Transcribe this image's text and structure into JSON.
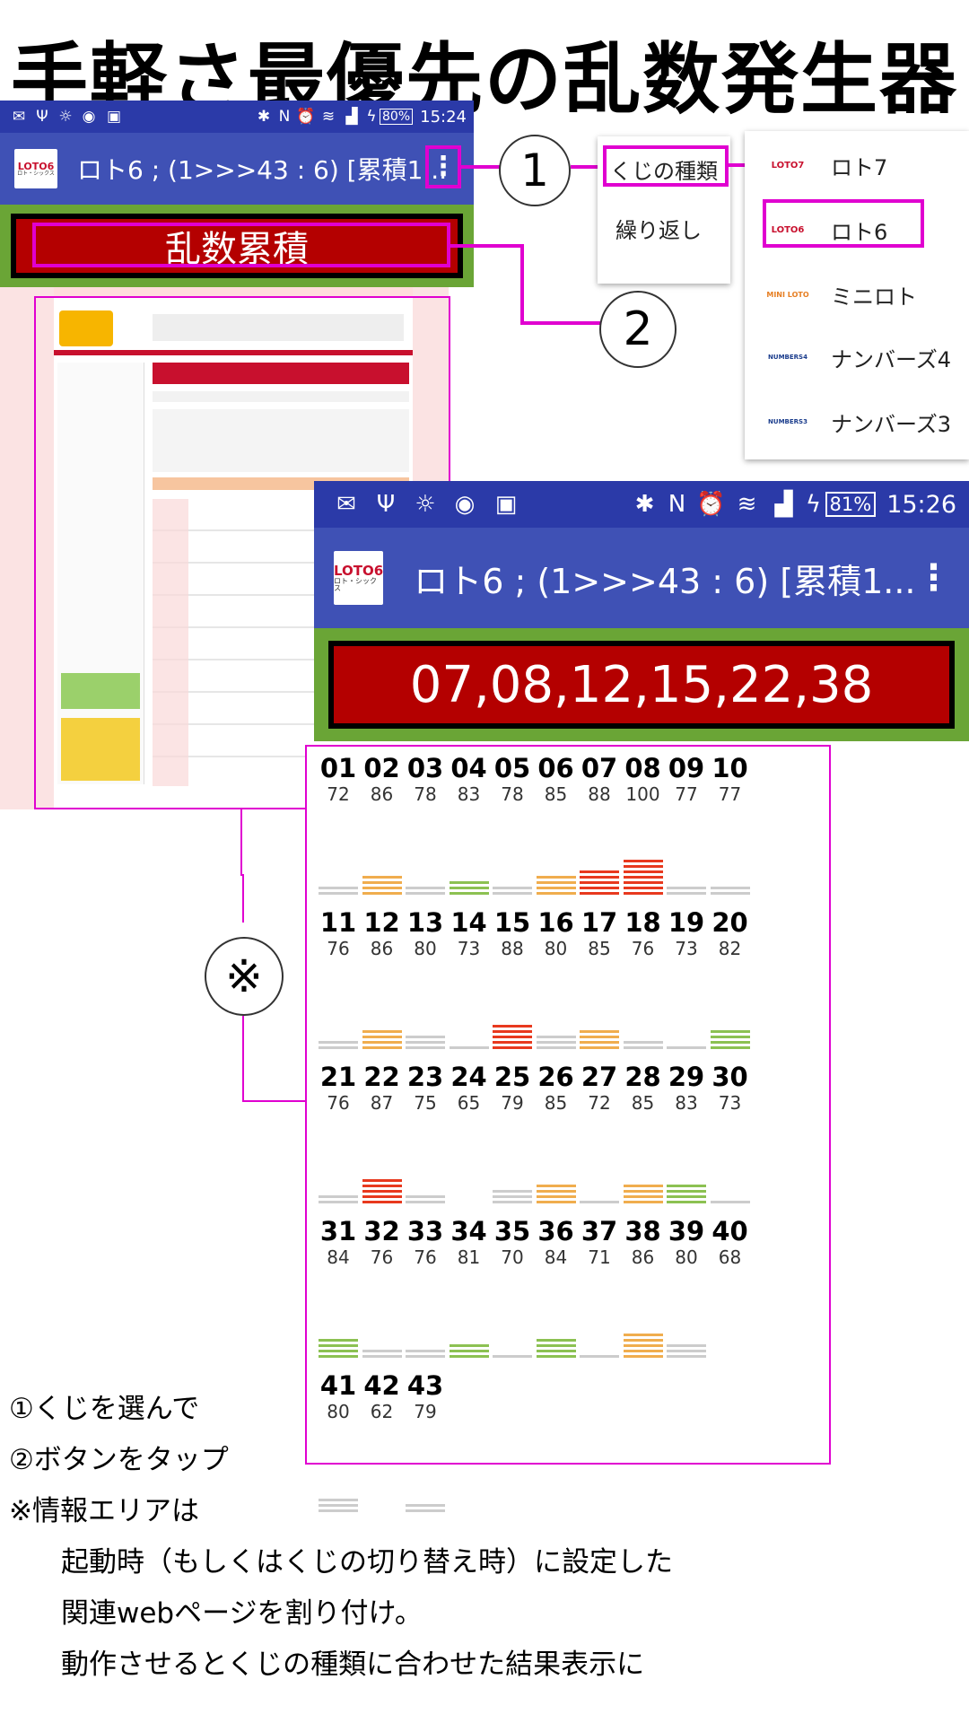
{
  "title": "手軽さ最優先の乱数発生器",
  "phone1": {
    "status": {
      "battery": "80%",
      "time": "15:24"
    },
    "appbar_title": "ロト6 ; (1>>>43 : 6) [累積1...",
    "logo_main": "LOTO6",
    "logo_sub": "ロト・シックス",
    "button_label": "乱数累積"
  },
  "markers": {
    "one": "1",
    "two": "2",
    "ref": "※"
  },
  "menu1": {
    "items": [
      "くじの種類",
      "繰り返し"
    ]
  },
  "menu2": {
    "items": [
      {
        "logo": "LOTO7",
        "label": "ロト7"
      },
      {
        "logo": "LOTO6",
        "label": "ロト6"
      },
      {
        "logo": "MINI LOTO",
        "label": "ミニロト"
      },
      {
        "logo": "NUMBERS4",
        "label": "ナンバーズ4"
      },
      {
        "logo": "NUMBERS3",
        "label": "ナンバーズ3"
      }
    ]
  },
  "phone2": {
    "status": {
      "battery": "81%",
      "time": "15:26"
    },
    "appbar_title": "ロト6 ; (1>>>43 : 6) [累積1...",
    "logo_main": "LOTO6",
    "logo_sub": "ロト・シックス",
    "result": "07,08,12,15,22,38"
  },
  "numbers": [
    {
      "n": "01",
      "c": "72",
      "lv": 2,
      "col": "#cccccc"
    },
    {
      "n": "02",
      "c": "86",
      "lv": 4,
      "col": "#f0ad4e"
    },
    {
      "n": "03",
      "c": "78",
      "lv": 2,
      "col": "#cccccc"
    },
    {
      "n": "04",
      "c": "83",
      "lv": 3,
      "col": "#8cc152"
    },
    {
      "n": "05",
      "c": "78",
      "lv": 2,
      "col": "#cccccc"
    },
    {
      "n": "06",
      "c": "85",
      "lv": 4,
      "col": "#f0ad4e"
    },
    {
      "n": "07",
      "c": "88",
      "lv": 5,
      "col": "#e8391e"
    },
    {
      "n": "08",
      "c": "100",
      "lv": 7,
      "col": "#e8391e"
    },
    {
      "n": "09",
      "c": "77",
      "lv": 2,
      "col": "#cccccc"
    },
    {
      "n": "10",
      "c": "77",
      "lv": 2,
      "col": "#cccccc"
    },
    {
      "n": "11",
      "c": "76",
      "lv": 2,
      "col": "#cccccc"
    },
    {
      "n": "12",
      "c": "86",
      "lv": 4,
      "col": "#f0ad4e"
    },
    {
      "n": "13",
      "c": "80",
      "lv": 3,
      "col": "#cccccc"
    },
    {
      "n": "14",
      "c": "73",
      "lv": 1,
      "col": "#cccccc"
    },
    {
      "n": "15",
      "c": "88",
      "lv": 5,
      "col": "#e8391e"
    },
    {
      "n": "16",
      "c": "80",
      "lv": 3,
      "col": "#cccccc"
    },
    {
      "n": "17",
      "c": "85",
      "lv": 4,
      "col": "#f0ad4e"
    },
    {
      "n": "18",
      "c": "76",
      "lv": 2,
      "col": "#cccccc"
    },
    {
      "n": "19",
      "c": "73",
      "lv": 1,
      "col": "#cccccc"
    },
    {
      "n": "20",
      "c": "82",
      "lv": 4,
      "col": "#8cc152"
    },
    {
      "n": "21",
      "c": "76",
      "lv": 2,
      "col": "#cccccc"
    },
    {
      "n": "22",
      "c": "87",
      "lv": 5,
      "col": "#e8391e"
    },
    {
      "n": "23",
      "c": "75",
      "lv": 2,
      "col": "#cccccc"
    },
    {
      "n": "24",
      "c": "65",
      "lv": 0,
      "col": "#cccccc"
    },
    {
      "n": "25",
      "c": "79",
      "lv": 3,
      "col": "#cccccc"
    },
    {
      "n": "26",
      "c": "85",
      "lv": 4,
      "col": "#f0ad4e"
    },
    {
      "n": "27",
      "c": "72",
      "lv": 1,
      "col": "#cccccc"
    },
    {
      "n": "28",
      "c": "85",
      "lv": 4,
      "col": "#f0ad4e"
    },
    {
      "n": "29",
      "c": "83",
      "lv": 4,
      "col": "#8cc152"
    },
    {
      "n": "30",
      "c": "73",
      "lv": 1,
      "col": "#cccccc"
    },
    {
      "n": "31",
      "c": "84",
      "lv": 4,
      "col": "#8cc152"
    },
    {
      "n": "32",
      "c": "76",
      "lv": 2,
      "col": "#cccccc"
    },
    {
      "n": "33",
      "c": "76",
      "lv": 2,
      "col": "#cccccc"
    },
    {
      "n": "34",
      "c": "81",
      "lv": 3,
      "col": "#8cc152"
    },
    {
      "n": "35",
      "c": "70",
      "lv": 1,
      "col": "#cccccc"
    },
    {
      "n": "36",
      "c": "84",
      "lv": 4,
      "col": "#8cc152"
    },
    {
      "n": "37",
      "c": "71",
      "lv": 1,
      "col": "#cccccc"
    },
    {
      "n": "38",
      "c": "86",
      "lv": 5,
      "col": "#f0ad4e"
    },
    {
      "n": "39",
      "c": "80",
      "lv": 3,
      "col": "#cccccc"
    },
    {
      "n": "40",
      "c": "68",
      "lv": 0,
      "col": "#cccccc"
    },
    {
      "n": "41",
      "c": "80",
      "lv": 3,
      "col": "#cccccc"
    },
    {
      "n": "42",
      "c": "62",
      "lv": 0,
      "col": "#cccccc"
    },
    {
      "n": "43",
      "c": "79",
      "lv": 2,
      "col": "#cccccc"
    }
  ],
  "notes": [
    "①くじを選んで",
    "②ボタンをタップ",
    "※情報エリアは",
    "起動時（もしくはくじの切り替え時）に設定した",
    "関連webページを割り付け。",
    "動作させるとくじの種類に合わせた結果表示に"
  ]
}
